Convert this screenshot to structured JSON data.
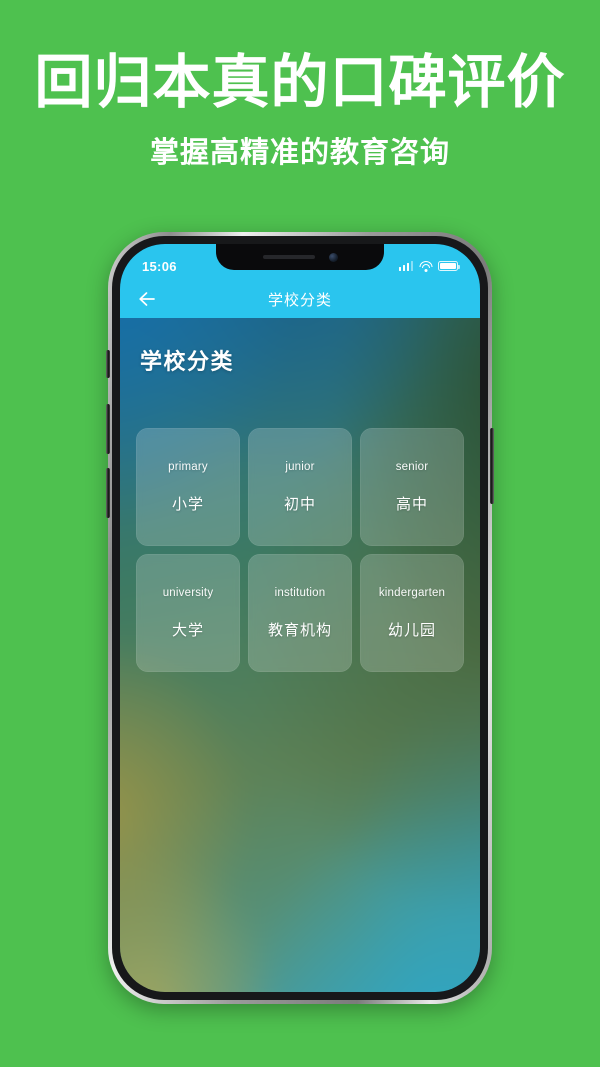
{
  "promo": {
    "headline": "回归本真的口碑评价",
    "subhead": "掌握高精准的教育咨询",
    "background_color": "#4ec14f",
    "text_color": "#ffffff"
  },
  "phone": {
    "status_bar": {
      "time": "15:06",
      "signal_icon": "cellular-signal-icon",
      "signal_bars_filled": 3,
      "signal_bars_total": 4,
      "wifi_icon": "wifi-icon",
      "battery_icon": "battery-icon",
      "battery_level": 100
    },
    "nav_bar": {
      "back_icon": "arrow-left-icon",
      "title": "学校分类",
      "background_color": "#2ac5ee",
      "text_color": "#ffffff"
    },
    "screen": {
      "page_title": "学校分类",
      "categories": [
        {
          "en": "primary",
          "cn": "小学"
        },
        {
          "en": "junior",
          "cn": "初中"
        },
        {
          "en": "senior",
          "cn": "高中"
        },
        {
          "en": "university",
          "cn": "大学"
        },
        {
          "en": "institution",
          "cn": "教育机构"
        },
        {
          "en": "kindergarten",
          "cn": "幼儿园"
        }
      ]
    },
    "hardware": {
      "mute_switch": "mute-switch",
      "volume_up": "volume-up-button",
      "volume_down": "volume-down-button",
      "power": "power-button",
      "speaker": "earpiece-speaker",
      "camera": "front-camera"
    }
  }
}
